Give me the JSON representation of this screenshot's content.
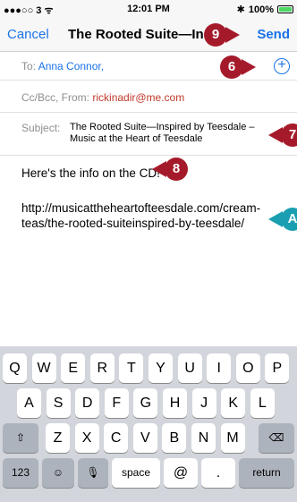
{
  "status": {
    "signal": "●●●○○ 3 ᯤ",
    "time": "12:01 PM",
    "bt": "✱",
    "battery_pct": "100%",
    "battery_level": 1.0
  },
  "nav": {
    "cancel": "Cancel",
    "title": "The Rooted Suite—Insp",
    "send": "Send"
  },
  "to": {
    "label": "To:",
    "name": "Anna Connor,"
  },
  "cc": {
    "label": "Cc/Bcc, From:",
    "email": "rickinadir@me.com"
  },
  "subject": {
    "label": "Subject:",
    "value": "The Rooted Suite—Inspired by Teesdale – Music at the Heart of Teesdale"
  },
  "body": {
    "line1": "Here's the info on the CD!",
    "url": "http://musicattheheartofteesdale.com/cream-teas/the-rooted-suiteinspired-by-teesdale/"
  },
  "callouts": {
    "send": "9",
    "add_contact": "6",
    "subject": "7",
    "body": "8",
    "url": "A"
  },
  "keyboard": {
    "row1": [
      "Q",
      "W",
      "E",
      "R",
      "T",
      "Y",
      "U",
      "I",
      "O",
      "P"
    ],
    "row2": [
      "A",
      "S",
      "D",
      "F",
      "G",
      "H",
      "J",
      "K",
      "L"
    ],
    "row3": [
      "Z",
      "X",
      "C",
      "V",
      "B",
      "N",
      "M"
    ],
    "shift": "⇧",
    "delete": "⌫",
    "numbers": "123",
    "emoji": "☺",
    "mic": "🎙",
    "space": "space",
    "at": "@",
    "dot": ".",
    "return": "return"
  },
  "colors": {
    "link_blue": "#1a73e8",
    "callout_red": "#a51a2a",
    "callout_teal": "#1a9fb1",
    "keyboard_bg": "#d2d5db"
  }
}
